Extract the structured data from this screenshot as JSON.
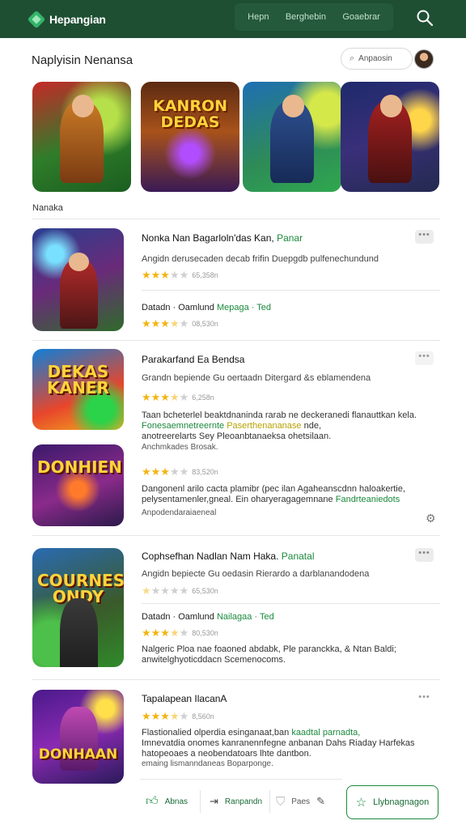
{
  "header": {
    "brand": "Hepangian",
    "nav": [
      "Hepn",
      "Berghebin",
      "Goaebrar"
    ],
    "search_icon": "search-icon"
  },
  "section": {
    "title": "Naplyisin Nenansa",
    "search_placeholder": "Anpaosin",
    "category_label": "Nanaka"
  },
  "featured": [
    {
      "title": ""
    },
    {
      "title": "KANRON DEDAS"
    },
    {
      "title": ""
    },
    {
      "title": ""
    }
  ],
  "items": [
    {
      "title": "Nonka Nan Bagarloln'das Kan,",
      "title_tag": "Panar",
      "desc": "Angidn derusecaden decab frifin Duepgdb pulfenechundund",
      "rating": 3,
      "rating_text": "65,358n",
      "sub_label": "Datadn · Oamlund",
      "sub_tag": "Mepaga · Ted",
      "sub_rating": 3.5,
      "sub_rating_text": "08,530n"
    },
    {
      "title": "Parakarfand Ea Bendsa",
      "desc": "Grandn bepiende Gu oertaadn Ditergard &s eblamendena",
      "rating": 3.5,
      "rating_text": "6,258n",
      "para_l1": "Taan bcheterlel beaktdnaninda rarab ne deckeranedi flanauttkan kela.",
      "para_l2_a": "Fonesaemnetreernte",
      "para_l2_b": "Paserthenananase",
      "para_l2_c": "nde,",
      "para_l3": "anotreerelarts Sey Pleoanbtanaeksa ohetsilaan.",
      "meta": "Anchmkades Brosak.",
      "thumb_text": "DEKAS KANER"
    },
    {
      "thumb_text": "DONHIEN",
      "rating": 3,
      "rating_text": "83,520n",
      "para_l1": "Dangonenl arilo cacta plamibr (pec ilan Agaheanscdnn haloakertie,",
      "para_l2_a": "pelysentamenler,gneal. Ein oharyeragagemnane",
      "para_l2_b": "Fandrteaniedots",
      "meta": "Anpodendaraiaeneal"
    },
    {
      "title": "Cophsefhan Nadlan Nam Haka.",
      "title_tag": "Panatal",
      "desc": "Angidn bepiecte Gu oedasin Rierardo a darblanandodena",
      "rating": 1.5,
      "rating_text": "65,530n",
      "sub_label": "Datadn · Oamlund",
      "sub_tag": "Nailagaa · Ted",
      "sub_rating": 3.5,
      "sub_rating_text": "80,530n",
      "para_l1": "Nalgeric Ploa nae foaoned abdabk, Ple paranckka, & Ntan Baldi;",
      "para_l2": "anwitelghyoticddacn Scemenocoms.",
      "thumb_text": "COURNES ONDY"
    },
    {
      "title": "Tapalapean IlacanA",
      "rating": 3.5,
      "rating_text": "8,560n",
      "para_l1_a": "Flastionalied olperdia esinganaat,ban",
      "para_l1_b": "kaadtal parnadta,",
      "para_l2": "Imnevatdia onomes kanranennfegne anbanan Dahs Riaday Harfekas",
      "para_l3": "hatopeoaes a neobendatoars lhte dantbon.",
      "meta": "emaing lismanndaneas Boparponge.",
      "thumb_text": "DONHAAN"
    }
  ],
  "actions": {
    "a1": "Abnas",
    "a2": "Ranpandn",
    "a3": "Paes",
    "primary": "Llybnagnagon"
  }
}
